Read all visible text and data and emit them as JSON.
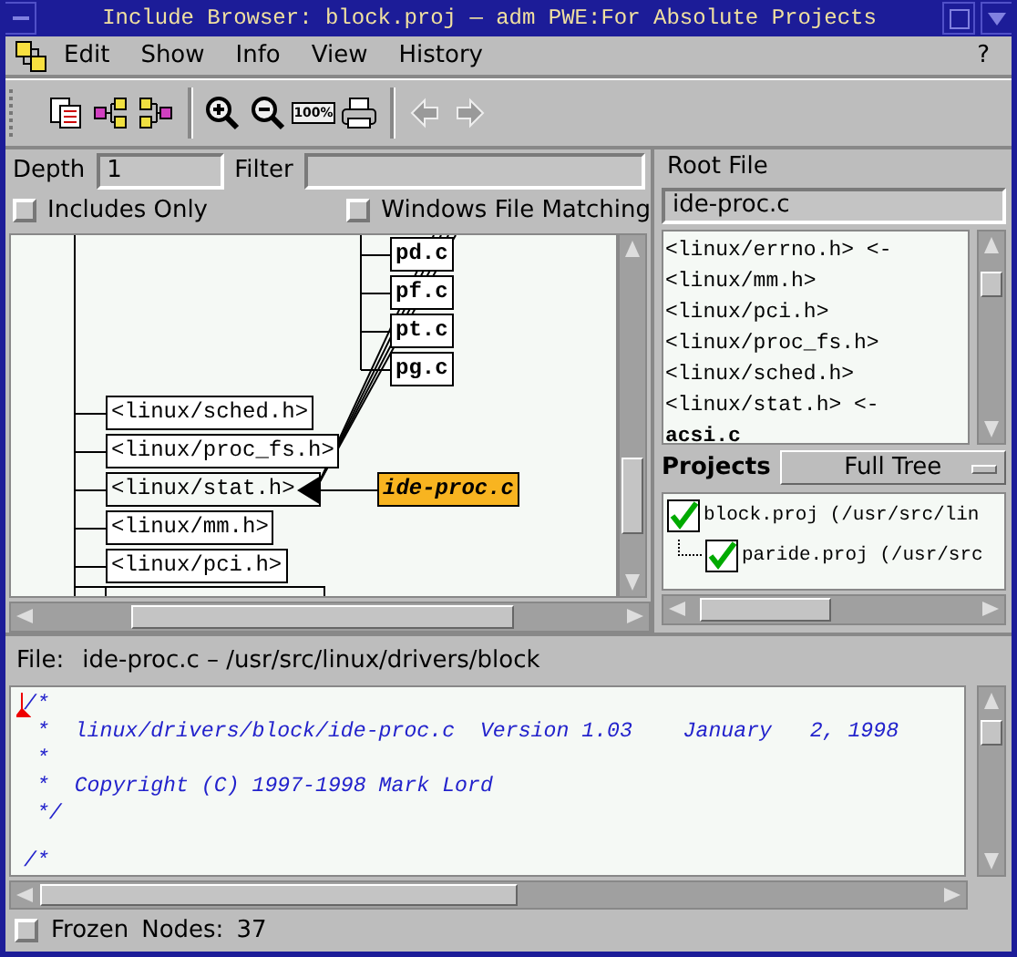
{
  "window": {
    "title": "Include Browser: block.proj — adm PWE:For Absolute Projects"
  },
  "menu": [
    "Edit",
    "Show",
    "Info",
    "View",
    "History"
  ],
  "help_menu": "?",
  "toolbar": [
    [
      {
        "kind": "copy",
        "disabled": false
      },
      {
        "kind": "expand",
        "disabled": false
      },
      {
        "kind": "collapse",
        "disabled": false
      }
    ],
    [
      {
        "kind": "zoom-in",
        "disabled": false
      },
      {
        "kind": "zoom-out",
        "disabled": false
      },
      {
        "kind": "zoom-reset",
        "label": "100%",
        "disabled": false
      },
      {
        "kind": "print",
        "disabled": false
      }
    ],
    [
      {
        "kind": "back",
        "disabled": true
      },
      {
        "kind": "forward",
        "disabled": true
      }
    ]
  ],
  "filters": {
    "depth_label": "Depth",
    "depth": "1",
    "filter_label": "Filter"
  },
  "includes_only": {
    "label": "Includes Only",
    "checked": false
  },
  "windows_matching": {
    "label": "Windows File Matching",
    "checked": false
  },
  "graph": {
    "sources": [
      {
        "label": "pd.c"
      },
      {
        "label": "pf.c"
      },
      {
        "label": "pt.c"
      },
      {
        "label": "pg.c"
      }
    ],
    "headers": [
      {
        "label": "<linux/sched.h>",
        "linked": false
      },
      {
        "label": "<linux/proc_fs.h>",
        "linked": false
      },
      {
        "label": "<linux/stat.h>",
        "linked": true
      },
      {
        "label": "<linux/mm.h>",
        "linked": false
      },
      {
        "label": "<linux/pci.h>",
        "linked": false
      }
    ],
    "root": {
      "label": "ide-proc.c",
      "selected": true
    }
  },
  "root_file": {
    "label": "Root File",
    "value": "ide-proc.c"
  },
  "include_list": [
    {
      "text": "<linux/errno.h> <-",
      "kind": "header"
    },
    {
      "text": "<linux/mm.h>",
      "kind": "header"
    },
    {
      "text": "<linux/pci.h>",
      "kind": "header"
    },
    {
      "text": "<linux/proc_fs.h>",
      "kind": "header"
    },
    {
      "text": "<linux/sched.h>",
      "kind": "header"
    },
    {
      "text": "<linux/stat.h> <-",
      "kind": "header"
    },
    {
      "text": "acsi.c",
      "kind": "source"
    }
  ],
  "projects": {
    "label": "Projects",
    "view": "Full Tree",
    "tree": [
      {
        "label": "block.proj (/usr/src/lin",
        "checked": true,
        "children": [
          {
            "label": "paride.proj (/usr/src",
            "checked": true
          }
        ]
      }
    ]
  },
  "file_info": {
    "label": "File:",
    "value": "ide-proc.c – /usr/src/linux/drivers/block"
  },
  "code_lines": [
    {
      "text": "/*",
      "gap_before": false
    },
    {
      "text": " *  linux/drivers/block/ide-proc.c  Version 1.03    January   2, 1998",
      "gap_before": false
    },
    {
      "text": " *",
      "gap_before": false
    },
    {
      "text": " *  Copyright (C) 1997-1998 Mark Lord",
      "gap_before": false
    },
    {
      "text": " */",
      "gap_before": false
    },
    {
      "text": "/*",
      "gap_before": true
    }
  ],
  "status": {
    "frozen": {
      "label": "Frozen",
      "checked": false
    },
    "nodes_label": "Nodes:",
    "nodes": "37"
  }
}
